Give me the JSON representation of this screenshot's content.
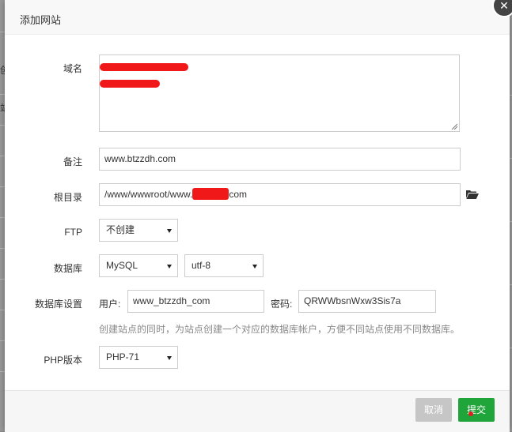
{
  "dialog": {
    "title": "添加网站",
    "close_label": "✕"
  },
  "form": {
    "domain": {
      "label": "域名",
      "value": ""
    },
    "remark": {
      "label": "备注",
      "value": "www.btzzdh.com"
    },
    "root": {
      "label": "根目录",
      "value_prefix": "/www/wwwroot/www.",
      "value_suffix": "com"
    },
    "ftp": {
      "label": "FTP",
      "selected": "不创建"
    },
    "database": {
      "label": "数据库",
      "type_selected": "MySQL",
      "charset_selected": "utf-8"
    },
    "db_settings": {
      "label": "数据库设置",
      "user_label": "用户:",
      "user_value": "www_btzzdh_com",
      "password_label": "密码:",
      "password_value": "QRWWbsnWxw3Sis7a",
      "hint": "创建站点的同时，为站点创建一个对应的数据库帐户，方便不同站点使用不同数据库。"
    },
    "php": {
      "label": "PHP版本",
      "selected": "PHP-71"
    }
  },
  "footer": {
    "cancel_label": "取消",
    "submit_label": "提交"
  },
  "background": {
    "left_chars": [
      "创",
      "站"
    ]
  },
  "colors": {
    "submit": "#20a53a",
    "cancel": "#c6c6c6",
    "redaction": "#f01818"
  }
}
